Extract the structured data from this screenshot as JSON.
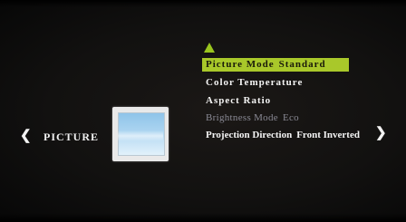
{
  "osd": {
    "section_title": "PICTURE",
    "nav_left_glyph": "❮",
    "nav_right_glyph": "❯",
    "up_indicator_icon": "triangle-up-icon",
    "picture_icon": "picture-screen-icon",
    "accent_color": "#a9c82a",
    "dim_color": "#8a8a95"
  },
  "menu": {
    "items": [
      {
        "label": "Picture Mode",
        "value": "Standard",
        "selected": true,
        "enabled": true
      },
      {
        "label": "Color Temperature",
        "value": "",
        "selected": false,
        "enabled": true
      },
      {
        "label": "Aspect Ratio",
        "value": "",
        "selected": false,
        "enabled": true
      },
      {
        "label": "Brightness Mode",
        "value": "Eco",
        "selected": false,
        "enabled": false
      },
      {
        "label": "Projection Direction",
        "value": "Front Inverted",
        "selected": false,
        "enabled": true
      }
    ]
  }
}
